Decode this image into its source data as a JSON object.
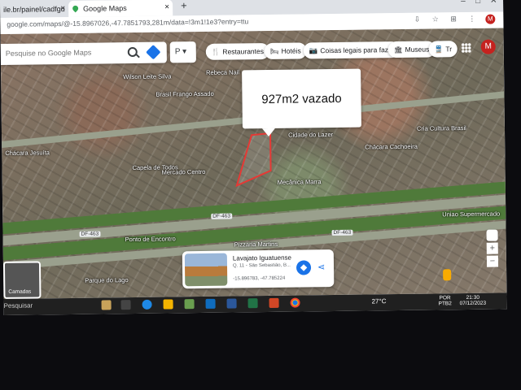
{
  "browser": {
    "tabs": [
      {
        "label": "ile.br/painel/cadfgu"
      },
      {
        "label": "Google Maps"
      }
    ],
    "new_tab": "+",
    "url": "google.com/maps/@-15.8967026,-47.7851793,281m/data=!3m1!1e3?entry=ttu",
    "profile_initial": "M"
  },
  "map": {
    "search": {
      "placeholder": "Pesquise no Google Maps"
    },
    "places_box": "P",
    "chips": [
      {
        "icon": "fork-knife-icon",
        "label": "Restaurantes"
      },
      {
        "icon": "bed-icon",
        "label": "Hotéis"
      },
      {
        "icon": "camera-icon",
        "label": "Coisas legais para faz..."
      },
      {
        "icon": "museum-icon",
        "label": "Museus"
      },
      {
        "icon": "transit-icon",
        "label": "Tr"
      }
    ],
    "profile_initial": "M",
    "annotation": "927m2 vazado",
    "roads": [
      "DF-463",
      "DF-463",
      "DF-463"
    ],
    "labels": [
      "Wilson Leite Silva",
      "Rebeca Nail",
      "Brasil Frango Assado",
      "Chácara Jesuíta",
      "Lavajato Iguatuense",
      "Mercado Centro",
      "Mecânica Marra",
      "Capela de Todos",
      "Chácara Cachoeira",
      "Cidade do Lazer",
      "Cria Cultura Brasil",
      "Uniao Supermercado",
      "Ponto de Encontro",
      "Pizzaria Martins",
      "Parque do Lago"
    ],
    "layers_label": "Camadas",
    "place_card": {
      "title": "Lavajato Iguatuense",
      "subtitle": "Q. 11 - São Sebastião, B...",
      "coords": "-15.896783, -47.785224"
    },
    "zoom_in": "+",
    "zoom_out": "−"
  },
  "taskbar": {
    "search": "Pesquisar",
    "weather": "27°C",
    "lang": "POR",
    "lang_sub": "PTB2",
    "time": "21:30",
    "date": "07/12/2023"
  }
}
